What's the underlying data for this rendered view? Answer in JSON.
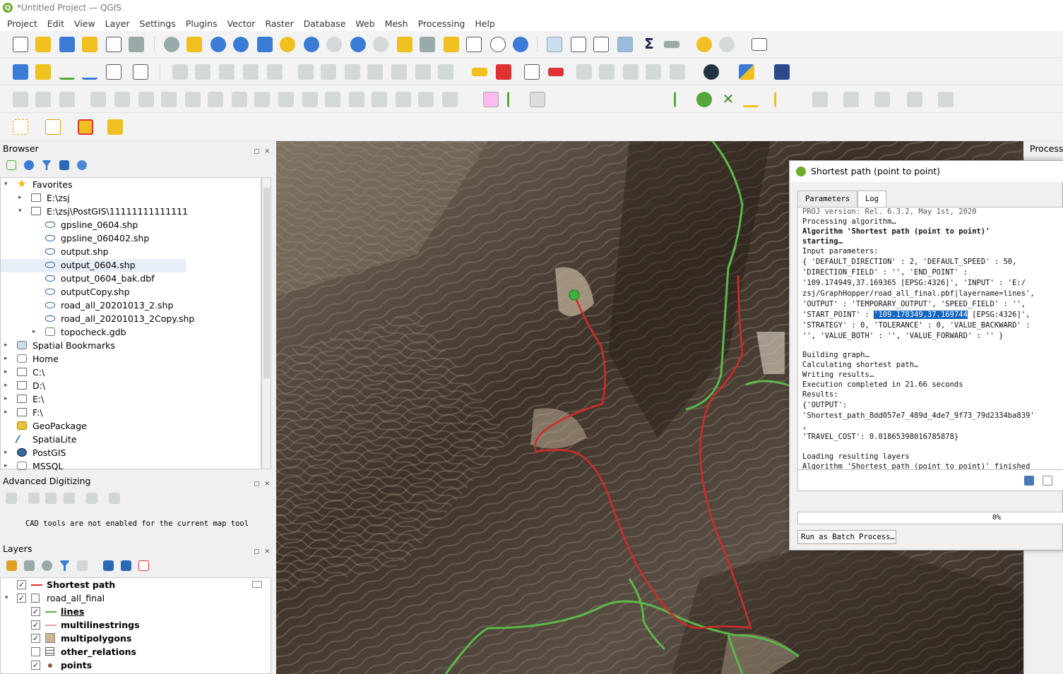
{
  "window": {
    "title": "*Untitled Project — QGIS"
  },
  "menu": [
    "Project",
    "Edit",
    "View",
    "Layer",
    "Settings",
    "Plugins",
    "Vector",
    "Raster",
    "Database",
    "Web",
    "Mesh",
    "Processing",
    "Help"
  ],
  "snapping": {
    "tolerance": "12",
    "unit": "px"
  },
  "browser": {
    "title": "Browser",
    "items": [
      {
        "label": "Favorites",
        "icon": "star-icon",
        "indent": 0,
        "expanded": true
      },
      {
        "label": "E:\\zsj",
        "icon": "folder-icon",
        "indent": 1,
        "expanded": false
      },
      {
        "label": "E:\\zsj\\PostGIS\\11111111111111",
        "icon": "folder-icon",
        "indent": 1,
        "expanded": true
      },
      {
        "label": "gpsline_0604.shp",
        "icon": "shapefile-icon",
        "indent": 2
      },
      {
        "label": "gpsline_060402.shp",
        "icon": "shapefile-icon",
        "indent": 2
      },
      {
        "label": "output.shp",
        "icon": "shapefile-icon",
        "indent": 2
      },
      {
        "label": "output_0604.shp",
        "icon": "shapefile-icon",
        "indent": 2,
        "selected": true
      },
      {
        "label": "output_0604_bak.dbf",
        "icon": "shapefile-icon",
        "indent": 2
      },
      {
        "label": "outputCopy.shp",
        "icon": "shapefile-icon",
        "indent": 2
      },
      {
        "label": "road_all_20201013_2.shp",
        "icon": "shapefile-icon",
        "indent": 2
      },
      {
        "label": "road_all_20201013_2Copy.shp",
        "icon": "shapefile-icon",
        "indent": 2
      },
      {
        "label": "topocheck.gdb",
        "icon": "database-icon",
        "indent": 2,
        "expanded": false
      },
      {
        "label": "Spatial Bookmarks",
        "icon": "bookmark-icon",
        "indent": 0,
        "expanded": false
      },
      {
        "label": "Home",
        "icon": "home-icon",
        "indent": 0,
        "expanded": false
      },
      {
        "label": "C:\\",
        "icon": "folder-icon",
        "indent": 0,
        "expanded": false
      },
      {
        "label": "D:\\",
        "icon": "folder-icon",
        "indent": 0,
        "expanded": false
      },
      {
        "label": "E:\\",
        "icon": "folder-icon",
        "indent": 0,
        "expanded": false
      },
      {
        "label": "F:\\",
        "icon": "folder-icon",
        "indent": 0,
        "expanded": false
      },
      {
        "label": "GeoPackage",
        "icon": "geopackage-icon",
        "indent": 0
      },
      {
        "label": "SpatiaLite",
        "icon": "spatialite-icon",
        "indent": 0
      },
      {
        "label": "PostGIS",
        "icon": "postgis-icon",
        "indent": 0,
        "expanded": false
      },
      {
        "label": "MSSQL",
        "icon": "mssql-icon",
        "indent": 0,
        "expanded": false
      }
    ]
  },
  "advanced_digitizing": {
    "title": "Advanced Digitizing",
    "message": "CAD tools are not enabled for the current map tool"
  },
  "layers": {
    "title": "Layers",
    "items": [
      {
        "label": "Shortest path",
        "checked": true,
        "symbol": "line",
        "color": "#e03030",
        "indent": 0
      },
      {
        "label": "road_all_final",
        "checked": true,
        "symbol": "group",
        "indent": 0,
        "expanded": true
      },
      {
        "label": "lines",
        "checked": true,
        "symbol": "line",
        "color": "#55b040",
        "indent": 1,
        "underline": true
      },
      {
        "label": "multilinestrings",
        "checked": true,
        "symbol": "line",
        "color": "#e8a0a0",
        "indent": 1
      },
      {
        "label": "multipolygons",
        "checked": true,
        "symbol": "fill",
        "color": "#c9b792",
        "indent": 1
      },
      {
        "label": "other_relations",
        "checked": false,
        "symbol": "table",
        "indent": 1
      },
      {
        "label": "points",
        "checked": true,
        "symbol": "point",
        "color": "#8a5a3a",
        "indent": 1
      }
    ]
  },
  "processing_panel": {
    "title": "Process"
  },
  "dialog": {
    "title": "Shortest path (point to point)",
    "tabs": [
      {
        "label": "Parameters"
      },
      {
        "label": "Log",
        "active": true
      }
    ],
    "log": [
      "PROJ version: Rel. 6.3.2, May 1st, 2020",
      "Processing algorithm…",
      "Algorithm 'Shortest path (point to point)'",
      "starting…",
      "Input parameters:",
      "{ 'DEFAULT_DIRECTION' : 2, 'DEFAULT_SPEED' : 50,",
      "'DIRECTION_FIELD' : '', 'END_POINT' :",
      "'109.174949,37.169365 [EPSG:4326]', 'INPUT' : 'E:/",
      "zsj/GraphHopper/road_all_final.pbf|layername=lines',",
      "'OUTPUT' : 'TEMPORARY_OUTPUT', 'SPEED_FIELD' : '',",
      "'START_POINT' : ",
      "'109.178349,37.169744",
      " [EPSG:4326]',",
      "'STRATEGY' : 0, 'TOLERANCE' : 0, 'VALUE_BACKWARD' :",
      "'', 'VALUE_BOTH' : '', 'VALUE_FORWARD' : '' }",
      "Building graph…",
      "Calculating shortest path…",
      "Writing results…",
      "Execution completed in 21.66 seconds",
      "Results:",
      "{'OUTPUT':",
      "'Shortest_path_8dd057e7_489d_4de7_9f73_79d2334ba839'",
      ",",
      "'TRAVEL_COST': 0.01865398016785878}",
      "Loading resulting layers",
      "Algorithm 'Shortest path (point to point)' finished"
    ],
    "progress": "0%",
    "batch_button": "Run as Batch Process…"
  },
  "colors": {
    "route": "#d42a2a",
    "road": "#5cb84a",
    "start_point": "#3cb043"
  }
}
